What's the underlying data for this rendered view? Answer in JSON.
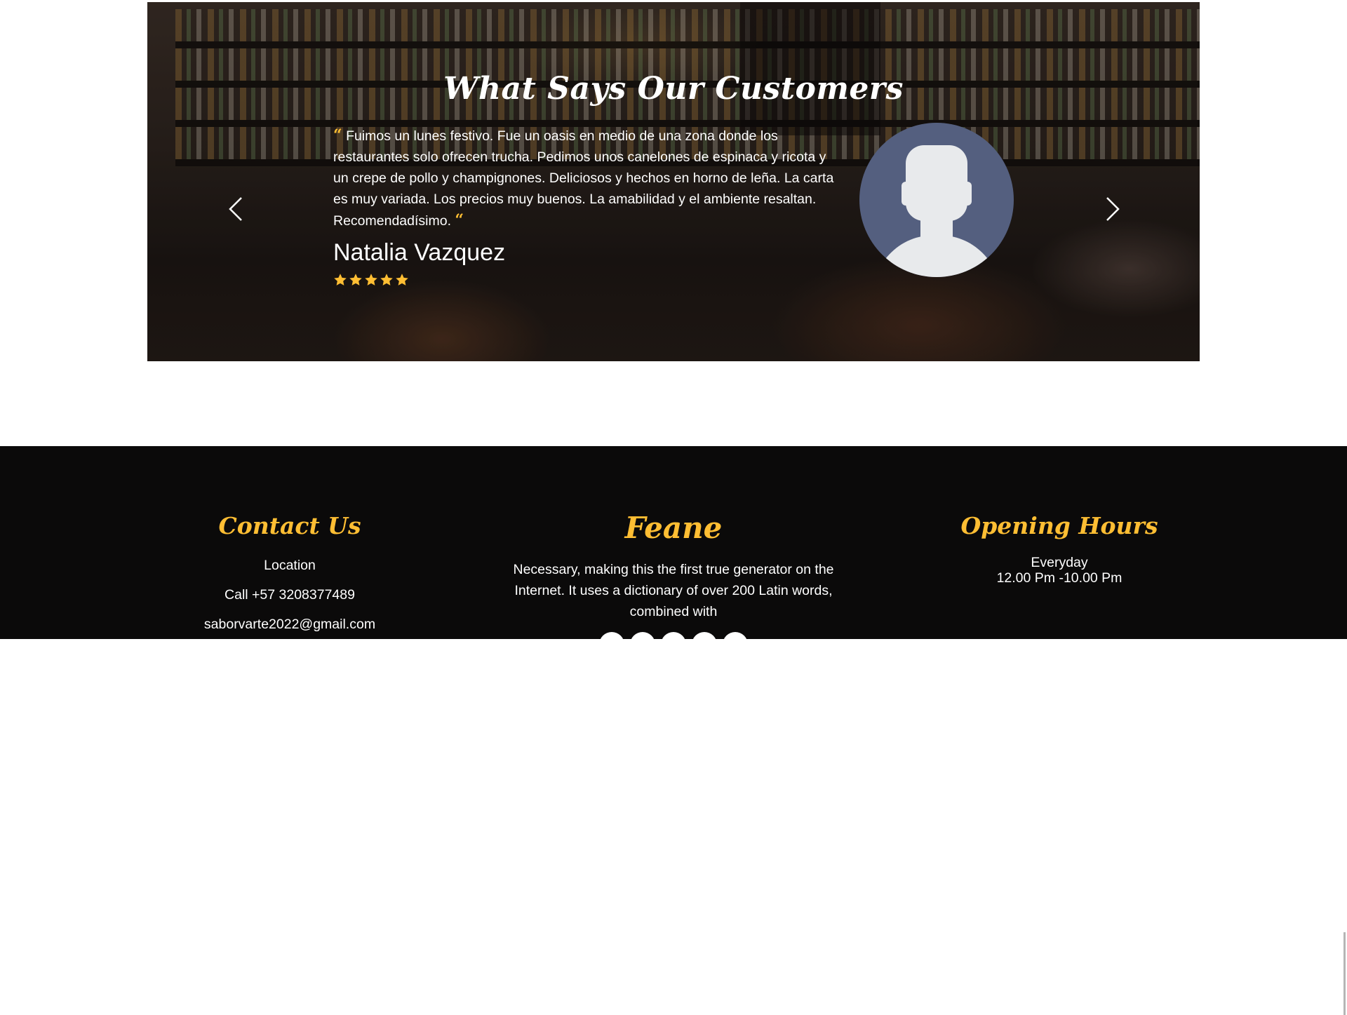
{
  "testimonials": {
    "title": "What Says Our Customers",
    "quote_open_mark": "“",
    "quote_close_mark": "“",
    "quote": "Fuimos un lunes festivo. Fue un oasis en medio de una zona donde los restaurantes solo ofrecen trucha. Pedimos unos canelones de espinaca y ricota y un crepe de pollo y champignones. Deliciosos y hechos en horno de leña. La carta es muy variada. Los precios muy buenos. La amabilidad y el ambiente resaltan. Recomendadísimo.",
    "reviewer_name": "Natalia Vazquez",
    "rating": 5,
    "rating_max": 5,
    "prev_icon": "chevron-left-icon",
    "next_icon": "chevron-right-icon",
    "avatar_icon": "user-silhouette-icon"
  },
  "footer": {
    "contact": {
      "heading": "Contact Us",
      "location": "Location",
      "phone": "Call +57 3208377489",
      "email": "saborvarte2022@gmail.com"
    },
    "about": {
      "heading": "Feane",
      "text": "Necessary, making this the first true generator on the Internet. It uses a dictionary of over 200 Latin words, combined with"
    },
    "hours": {
      "heading": "Opening Hours",
      "days": "Everyday",
      "time": "12.00 Pm -10.00 Pm"
    }
  },
  "colors": {
    "accent": "#ffbe33",
    "footer_background": "#0b0a0a",
    "avatar_background": "#545f7f",
    "text_light": "#ffffff"
  }
}
